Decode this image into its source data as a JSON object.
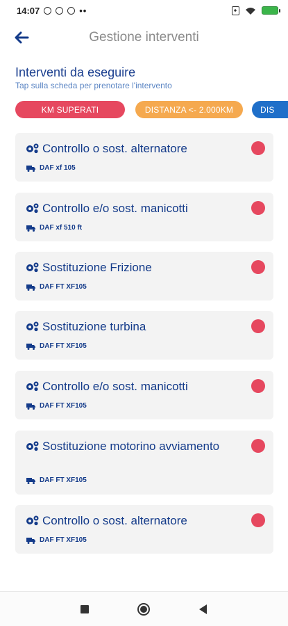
{
  "status_bar": {
    "time": "14:07",
    "dots": "••"
  },
  "header": {
    "title": "Gestione interventi",
    "back_icon": "arrow-left-icon"
  },
  "section": {
    "title": "Interventi da eseguire",
    "subtitle": "Tap sulla scheda per prenotare l'intervento"
  },
  "filters": {
    "km": "KM SUPERATI",
    "distance": "DISTANZA <- 2.000KM",
    "third": "DIS"
  },
  "colors": {
    "accent_blue": "#143b8a",
    "red": "#e6485f",
    "orange": "#f5a94f",
    "blue": "#1f6fc9"
  },
  "cards": [
    {
      "title": "Controllo o sost. alternatore",
      "vehicle": "DAF xf 105"
    },
    {
      "title": "Controllo e/o sost. manicotti",
      "vehicle": "DAF xf 510 ft"
    },
    {
      "title": "Sostituzione Frizione",
      "vehicle": "DAF FT XF105"
    },
    {
      "title": "Sostituzione turbina",
      "vehicle": "DAF FT XF105"
    },
    {
      "title": "Controllo e/o sost. manicotti",
      "vehicle": "DAF FT XF105"
    },
    {
      "title": "Sostituzione motorino avviamento",
      "vehicle": "DAF FT XF105"
    },
    {
      "title": "Controllo o sost. alternatore",
      "vehicle": "DAF FT XF105"
    }
  ]
}
